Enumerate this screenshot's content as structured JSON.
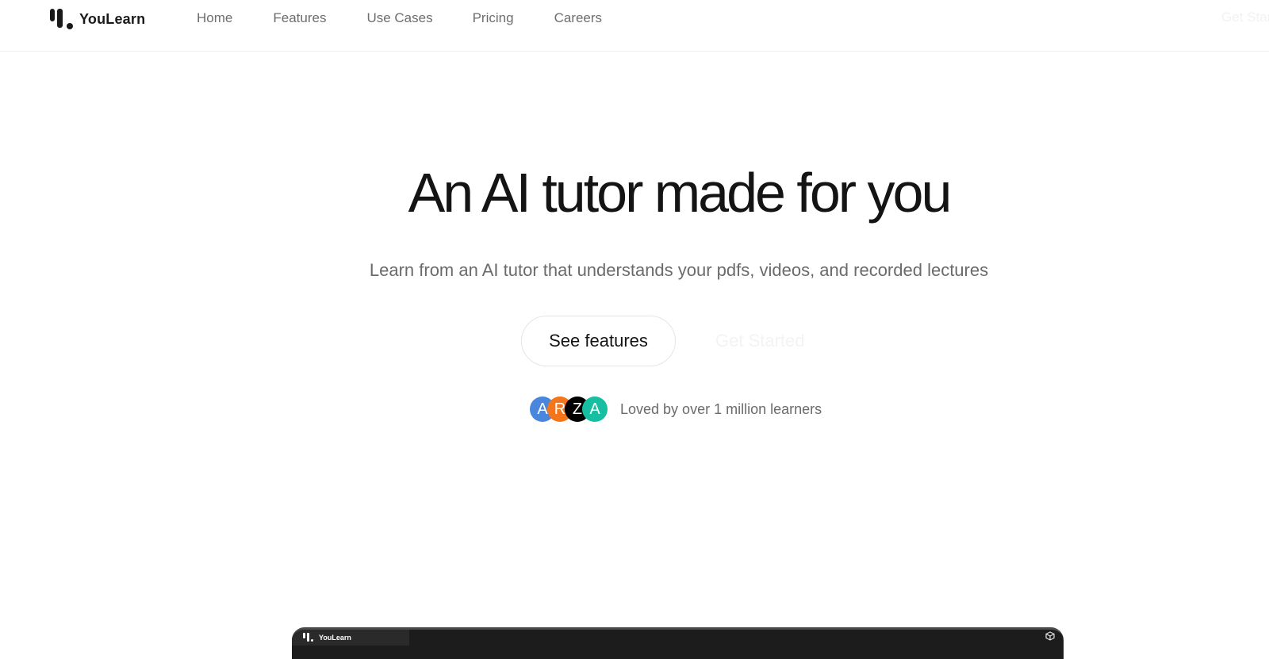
{
  "navbar": {
    "brand": "YouLearn",
    "links": [
      {
        "label": "Home"
      },
      {
        "label": "Features"
      },
      {
        "label": "Use Cases"
      },
      {
        "label": "Pricing"
      },
      {
        "label": "Careers"
      }
    ],
    "cta_label": "Get Started"
  },
  "hero": {
    "title": "An AI tutor made for you",
    "subtitle": "Learn from an AI tutor that understands your pdfs, videos, and recorded lectures",
    "primary_button": "See features",
    "secondary_button": "Get Started",
    "social_proof": {
      "avatars": [
        {
          "initial": "A",
          "color": "#4a86de"
        },
        {
          "initial": "R",
          "color": "#f5751a"
        },
        {
          "initial": "Z",
          "color": "#000000"
        },
        {
          "initial": "A",
          "color": "#16bfa2"
        }
      ],
      "text": "Loved by over 1 million learners"
    }
  },
  "preview": {
    "app_title": "YouLearn",
    "icon": "cube-icon"
  }
}
